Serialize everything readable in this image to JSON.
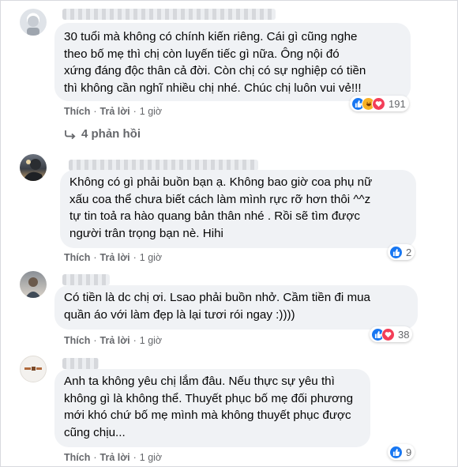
{
  "actions": {
    "like": "Thích",
    "reply": "Trả lời",
    "separator": "·"
  },
  "comments": [
    {
      "text": "30 tuổi mà không có chính kiến riêng. Cái gì cũng nghe\ntheo bố mẹ thì chị còn luyến tiếc gì nữa. Ông nội đó\nxứng đáng độc thân cả đời. Còn chị có sự nghiệp có tiền\nthì không cần nghĩ nhiều chị nhé. Chúc chị luôn vui vẻ!!!",
      "time": "1 giờ",
      "reaction_count": "191",
      "reactions": [
        "like-icon",
        "haha-icon",
        "love-icon"
      ]
    },
    {
      "text": "Không có gì phải buồn bạn ạ. Không bao giờ coa phụ nữ\nxấu coa thể chưa biết cách làm mình rực rỡ hơn thôi ^^z\ntự tin toả ra hào quang bản thân nhé . Rồi sẽ tìm được\nngười trân trọng bạn nè. Hihi",
      "time": "1 giờ",
      "reaction_count": "2",
      "reactions": [
        "like-icon"
      ]
    },
    {
      "text": "Có tiền là dc chị ơi. Lsao phải buồn nhở. Cầm tiền đi mua\nquần áo với làm đẹp là lại tươi rói ngay :))))",
      "time": "1 giờ",
      "reaction_count": "38",
      "reactions": [
        "like-icon",
        "love-icon"
      ]
    },
    {
      "text": "Anh ta không yêu chị lắm đâu. Nếu thực sự yêu thì\nkhông gì là không thể. Thuyết phục bố mẹ đối phương\nmới khó chứ bố mẹ mình mà không thuyết phục được\ncũng chịu...",
      "time": "1 giờ",
      "reaction_count": "9",
      "reactions": [
        "like-icon"
      ]
    }
  ],
  "replies_link": "4 phản hồi",
  "colors": {
    "bubble": "#f0f2f5",
    "meta": "#65676b",
    "like": "#1877f2",
    "love": "#f33e58",
    "haha": "#f7b125"
  }
}
